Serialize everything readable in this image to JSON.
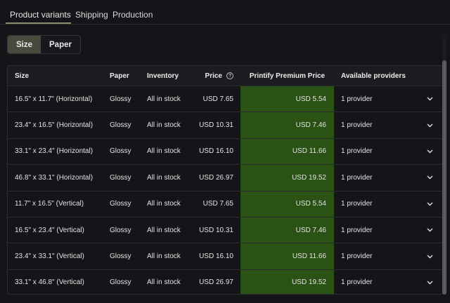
{
  "tabs": [
    {
      "label": "Product variants",
      "active": true
    },
    {
      "label": "Shipping",
      "active": false
    },
    {
      "label": "Production",
      "active": false
    }
  ],
  "segmented": {
    "size_label": "Size",
    "paper_label": "Paper",
    "selected": "Size"
  },
  "table": {
    "headers": {
      "size": "Size",
      "paper": "Paper",
      "inventory": "Inventory",
      "price": "Price",
      "premium": "Printify Premium Price",
      "providers": "Available providers"
    },
    "info_icon_glyph": "?",
    "chevron_glyph": "⌄",
    "rows": [
      {
        "size": "16.5\" x 11.7\" (Horizontal)",
        "paper": "Glossy",
        "inventory": "All in stock",
        "price": "USD 7.65",
        "premium": "USD 5.54",
        "providers": "1 provider"
      },
      {
        "size": "23.4\" x 16.5\" (Horizontal)",
        "paper": "Glossy",
        "inventory": "All in stock",
        "price": "USD 10.31",
        "premium": "USD 7.46",
        "providers": "1 provider"
      },
      {
        "size": "33.1\" x 23.4\" (Horizontal)",
        "paper": "Glossy",
        "inventory": "All in stock",
        "price": "USD 16.10",
        "premium": "USD 11.66",
        "providers": "1 provider"
      },
      {
        "size": "46.8\" x 33.1\" (Horizontal)",
        "paper": "Glossy",
        "inventory": "All in stock",
        "price": "USD 26.97",
        "premium": "USD 19.52",
        "providers": "1 provider"
      },
      {
        "size": "11.7\" x 16.5\" (Vertical)",
        "paper": "Glossy",
        "inventory": "All in stock",
        "price": "USD 7.65",
        "premium": "USD 5.54",
        "providers": "1 provider"
      },
      {
        "size": "16.5\" x 23.4\" (Vertical)",
        "paper": "Glossy",
        "inventory": "All in stock",
        "price": "USD 10.31",
        "premium": "USD 7.46",
        "providers": "1 provider"
      },
      {
        "size": "23.4\" x 33.1\" (Vertical)",
        "paper": "Glossy",
        "inventory": "All in stock",
        "price": "USD 16.10",
        "premium": "USD 11.66",
        "providers": "1 provider"
      },
      {
        "size": "33.1\" x 46.8\" (Vertical)",
        "paper": "Glossy",
        "inventory": "All in stock",
        "price": "USD 26.97",
        "premium": "USD 19.52",
        "providers": "1 provider"
      }
    ]
  },
  "colors": {
    "background": "#141518",
    "premium_column": "#2a5214",
    "premium_header": "#356a19",
    "selected_segment": "#4a4a3c",
    "tab_underline": "#8f8c74"
  }
}
